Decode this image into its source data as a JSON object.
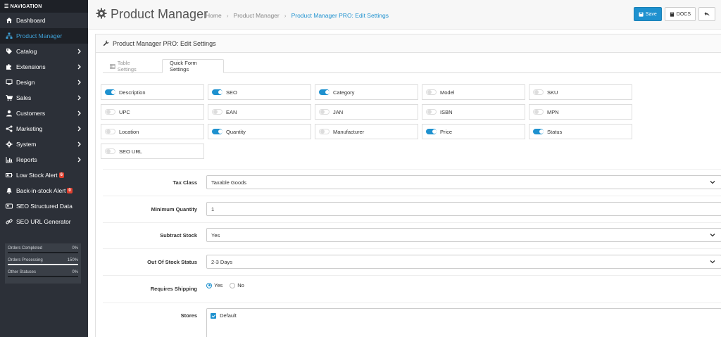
{
  "nav": {
    "header": "NAVIGATION",
    "items": [
      {
        "label": "Dashboard",
        "icon": "dashboard-icon",
        "chevron": false,
        "active": false
      },
      {
        "label": "Product Manager",
        "icon": "sitemap-icon",
        "chevron": false,
        "active": true
      },
      {
        "label": "Catalog",
        "icon": "tag-icon",
        "chevron": true,
        "active": false
      },
      {
        "label": "Extensions",
        "icon": "puzzle-icon",
        "chevron": true,
        "active": false
      },
      {
        "label": "Design",
        "icon": "monitor-icon",
        "chevron": true,
        "active": false
      },
      {
        "label": "Sales",
        "icon": "cart-icon",
        "chevron": true,
        "active": false
      },
      {
        "label": "Customers",
        "icon": "user-icon",
        "chevron": true,
        "active": false
      },
      {
        "label": "Marketing",
        "icon": "share-icon",
        "chevron": true,
        "active": false
      },
      {
        "label": "System",
        "icon": "cog-icon",
        "chevron": true,
        "active": false
      },
      {
        "label": "Reports",
        "icon": "chart-icon",
        "chevron": true,
        "active": false
      },
      {
        "label": "Low Stock Alert",
        "icon": "battery-icon",
        "chevron": false,
        "active": false,
        "badge": "6"
      },
      {
        "label": "Back-in-stock Alert",
        "icon": "bell-icon",
        "chevron": false,
        "active": false,
        "badge": "0"
      },
      {
        "label": "SEO Structured Data",
        "icon": "card-icon",
        "chevron": false,
        "active": false
      },
      {
        "label": "SEO URL Generator",
        "icon": "link-icon",
        "chevron": false,
        "active": false
      }
    ],
    "stats": [
      {
        "label": "Orders Completed",
        "value": "0%",
        "fill": 0
      },
      {
        "label": "Orders Processing",
        "value": "150%",
        "fill": 1
      },
      {
        "label": "Other Statuses",
        "value": "0%",
        "fill": 0
      }
    ]
  },
  "header": {
    "title": "Product Manager",
    "breadcrumb": [
      "Home",
      "Product Manager",
      "Product Manager PRO: Edit Settings"
    ],
    "save_label": "Save",
    "docs_label": "DOCS"
  },
  "panel": {
    "title": "Product Manager PRO: Edit Settings",
    "tabs": [
      "Table Settings",
      "Quick Form Settings"
    ],
    "active_tab": 1
  },
  "toggles": [
    {
      "label": "Description",
      "on": true
    },
    {
      "label": "SEO",
      "on": true
    },
    {
      "label": "Category",
      "on": true
    },
    {
      "label": "Model",
      "on": false
    },
    {
      "label": "SKU",
      "on": false
    },
    {
      "label": "UPC",
      "on": false
    },
    {
      "label": "EAN",
      "on": false
    },
    {
      "label": "JAN",
      "on": false
    },
    {
      "label": "ISBN",
      "on": false
    },
    {
      "label": "MPN",
      "on": false
    },
    {
      "label": "Location",
      "on": false
    },
    {
      "label": "Quantity",
      "on": true
    },
    {
      "label": "Manufacturer",
      "on": false
    },
    {
      "label": "Price",
      "on": true
    },
    {
      "label": "Status",
      "on": true
    },
    {
      "label": "SEO URL",
      "on": false
    }
  ],
  "form": {
    "tax_class": {
      "label": "Tax Class",
      "value": "Taxable Goods"
    },
    "minimum_quantity": {
      "label": "Minimum Quantity",
      "value": "1"
    },
    "subtract_stock": {
      "label": "Subtract Stock",
      "value": "Yes"
    },
    "out_of_stock_status": {
      "label": "Out Of Stock Status",
      "value": "2-3 Days"
    },
    "requires_shipping": {
      "label": "Requires Shipping",
      "options": [
        "Yes",
        "No"
      ],
      "selected": "Yes"
    },
    "stores": {
      "label": "Stores",
      "options": [
        "Default"
      ],
      "checked": [
        "Default"
      ]
    }
  },
  "colors": {
    "accent": "#1e91cf",
    "sidebar": "#2c3038",
    "badge": "#e0402f"
  }
}
